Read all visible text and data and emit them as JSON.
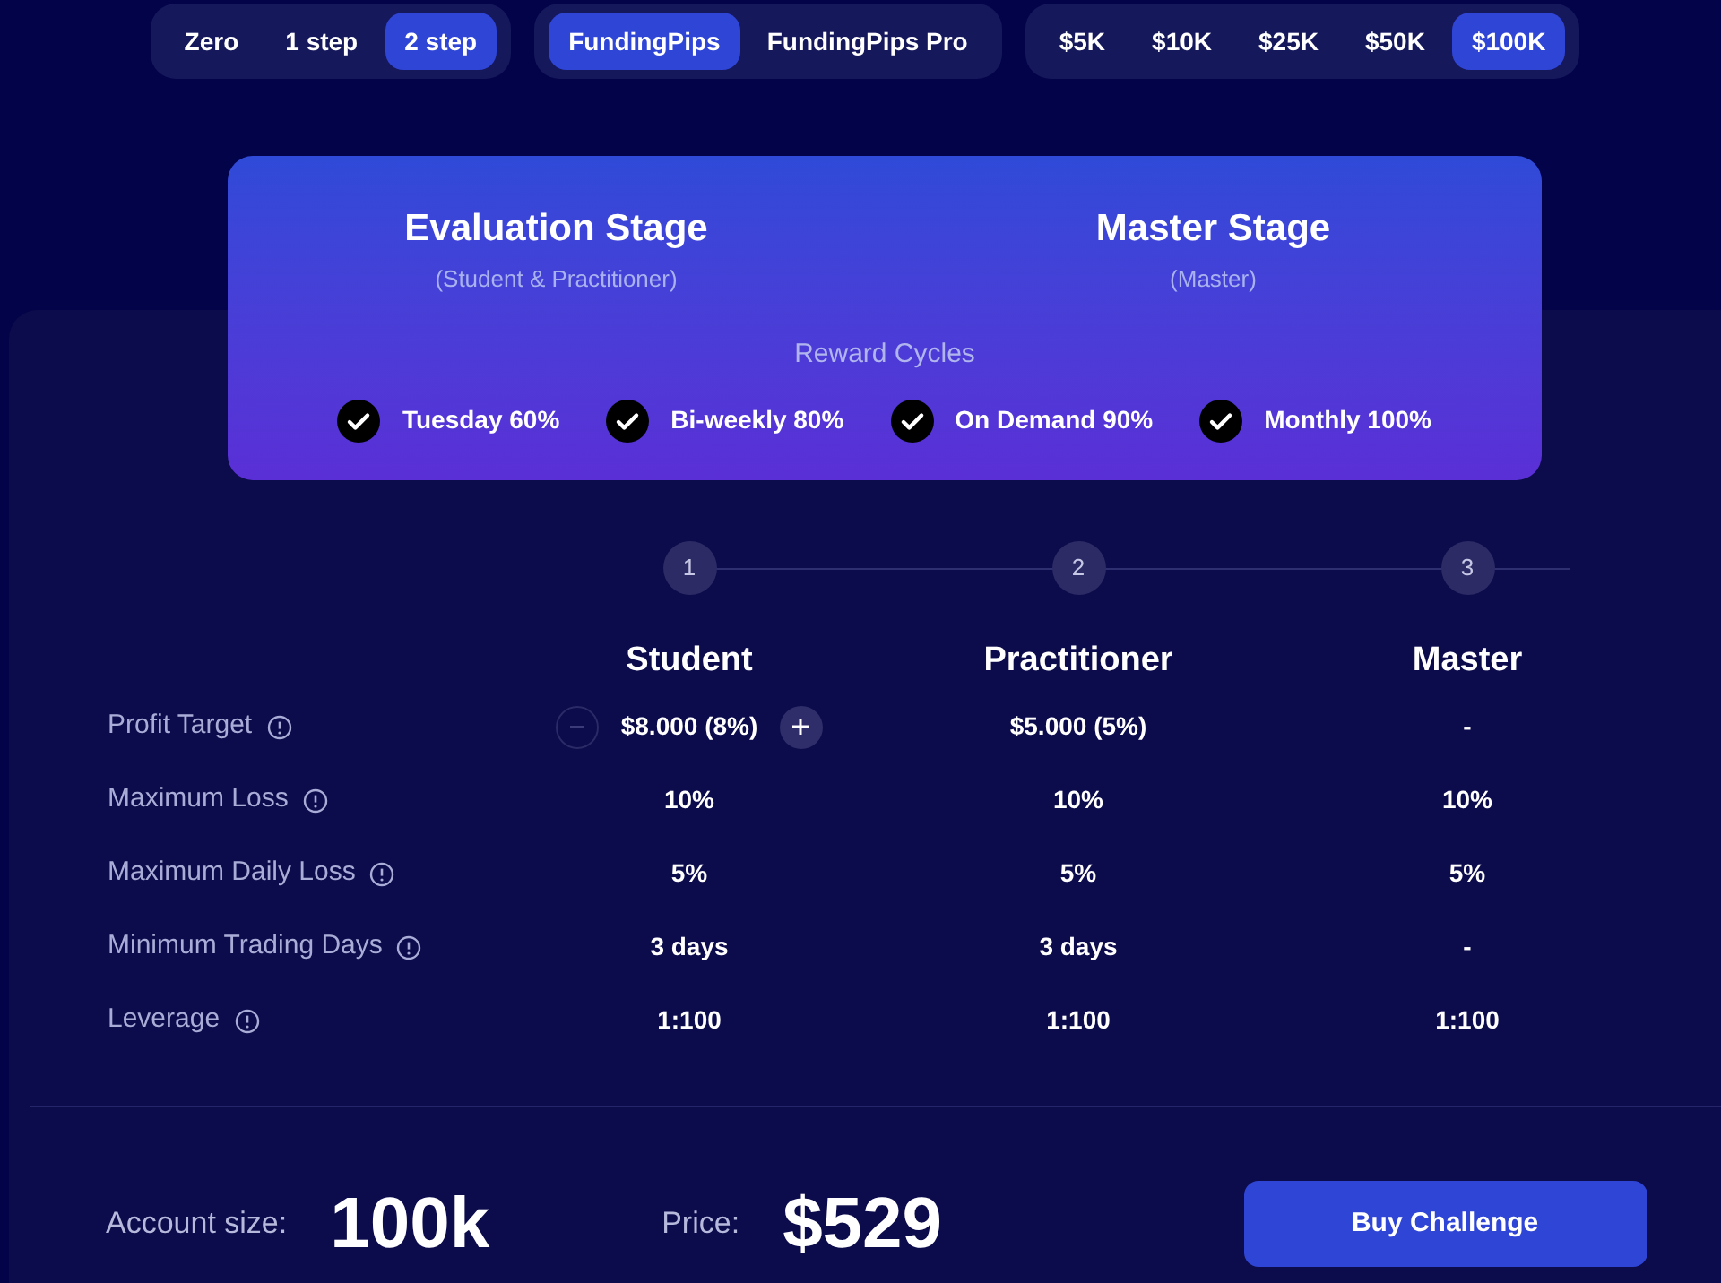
{
  "selectors": [
    {
      "options": [
        {
          "label": "Zero",
          "selected": false
        },
        {
          "label": "1 step",
          "selected": false
        },
        {
          "label": "2 step",
          "selected": true
        }
      ]
    },
    {
      "options": [
        {
          "label": "FundingPips",
          "selected": true
        },
        {
          "label": "FundingPips Pro",
          "selected": false
        }
      ]
    },
    {
      "options": [
        {
          "label": "$5K",
          "selected": false
        },
        {
          "label": "$10K",
          "selected": false
        },
        {
          "label": "$25K",
          "selected": false
        },
        {
          "label": "$50K",
          "selected": false
        },
        {
          "label": "$100K",
          "selected": true
        }
      ]
    }
  ],
  "stages": [
    {
      "title": "Evaluation Stage",
      "subtitle": "(Student & Practitioner)"
    },
    {
      "title": "Master Stage",
      "subtitle": "(Master)"
    }
  ],
  "reward_cycles": {
    "title": "Reward Cycles",
    "items": [
      {
        "label": "Tuesday 60%",
        "checked": true
      },
      {
        "label": "Bi-weekly 80%",
        "checked": true
      },
      {
        "label": "On Demand 90%",
        "checked": true
      },
      {
        "label": "Monthly 100%",
        "checked": true
      }
    ]
  },
  "phases": [
    {
      "step": "1",
      "name": "Student"
    },
    {
      "step": "2",
      "name": "Practitioner"
    },
    {
      "step": "3",
      "name": "Master"
    }
  ],
  "rules": [
    {
      "label": "Profit Target",
      "adjustable": true,
      "values": [
        "$8.000 (8%)",
        "$5.000 (5%)",
        "-"
      ]
    },
    {
      "label": "Maximum Loss",
      "adjustable": false,
      "values": [
        "10%",
        "10%",
        "10%"
      ]
    },
    {
      "label": "Maximum Daily Loss",
      "adjustable": false,
      "values": [
        "5%",
        "5%",
        "5%"
      ]
    },
    {
      "label": "Minimum Trading Days",
      "adjustable": false,
      "values": [
        "3 days",
        "3 days",
        "-"
      ]
    },
    {
      "label": "Leverage",
      "adjustable": false,
      "values": [
        "1:100",
        "1:100",
        "1:100"
      ]
    }
  ],
  "summary": {
    "account_label": "Account size:",
    "account_value": "100k",
    "price_label": "Price:",
    "price_value": "$529",
    "button": "Buy Challenge"
  }
}
